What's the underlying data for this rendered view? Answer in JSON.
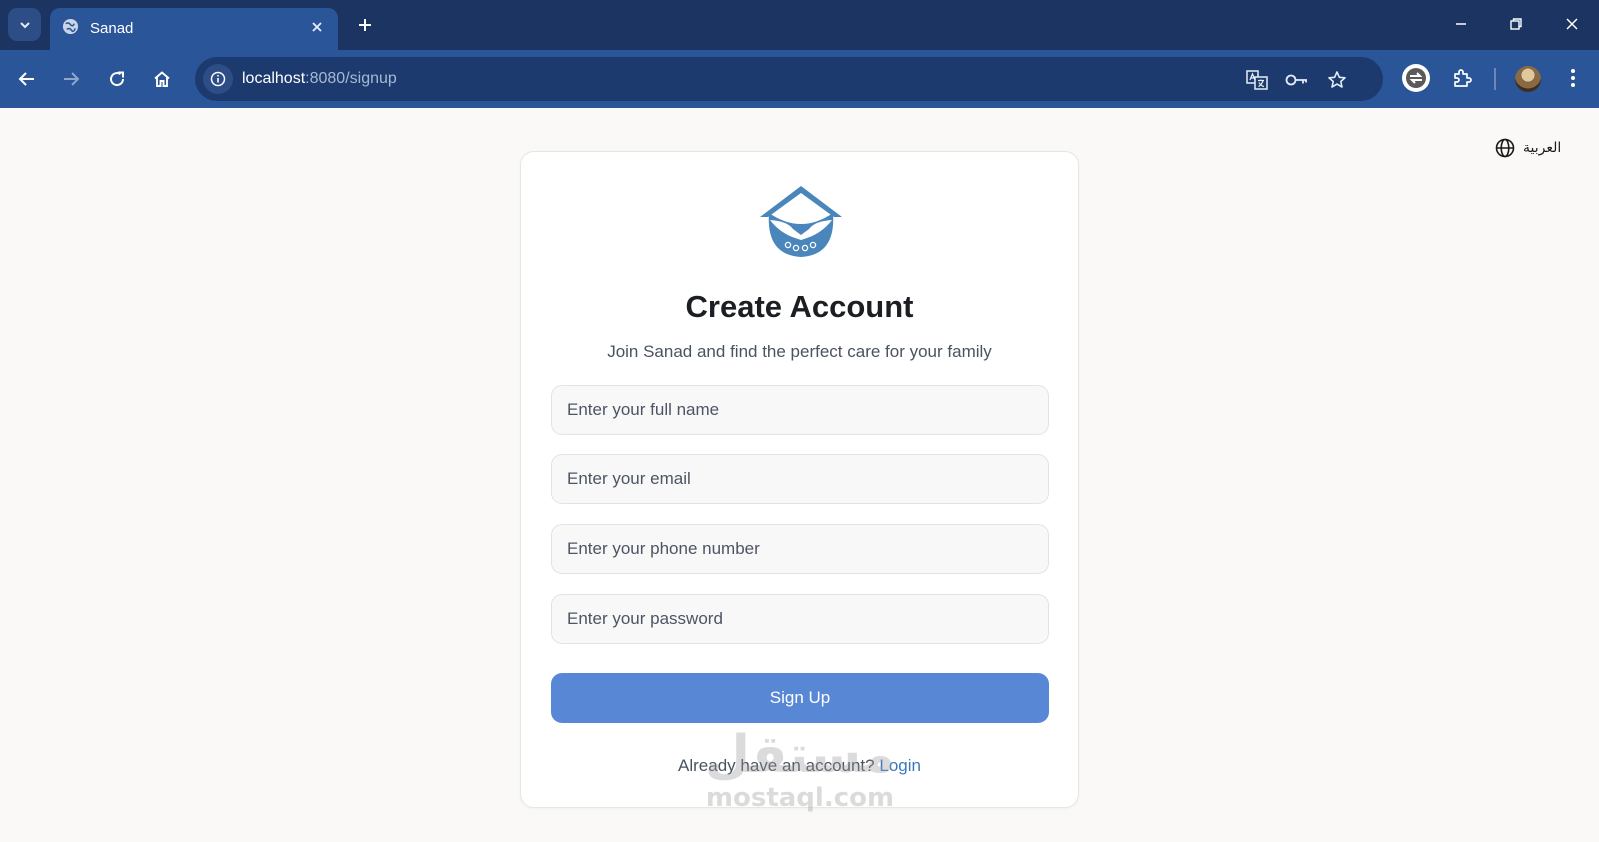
{
  "browser": {
    "tab": {
      "title": "Sanad"
    },
    "address": {
      "host": "localhost",
      "path": ":8080/signup"
    }
  },
  "page": {
    "language_toggle": "العربية",
    "card": {
      "title": "Create Account",
      "subtitle": "Join Sanad and find the perfect care for your family",
      "fields": {
        "full_name": {
          "placeholder": "Enter your full name",
          "value": ""
        },
        "email": {
          "placeholder": "Enter your email",
          "value": ""
        },
        "phone": {
          "placeholder": "Enter your phone number",
          "value": ""
        },
        "password": {
          "placeholder": "Enter your password",
          "value": ""
        }
      },
      "submit_label": "Sign Up",
      "login_prompt": "Already have an account?",
      "login_link": "Login"
    }
  },
  "watermark": {
    "arabic": "مستقل",
    "latin": "mostaql.com"
  },
  "icons": {
    "tab_favicon": "globe-icon",
    "tab_search": "chevron-down-icon",
    "new_tab": "plus-icon",
    "back": "arrow-left-icon",
    "forward": "arrow-right-icon",
    "reload": "reload-icon",
    "home": "home-icon",
    "site_info": "info-icon",
    "translate": "translate-icon",
    "passwords": "key-icon",
    "bookmark": "star-icon",
    "extension": "puzzle-icon",
    "menu": "kebab-icon",
    "language": "globe-icon"
  },
  "colors": {
    "tabbar": "#1c3461",
    "toolbar": "#2a5599",
    "primary_button": "#5887d6",
    "link": "#3a78c2",
    "logo": "#4a86bb"
  }
}
